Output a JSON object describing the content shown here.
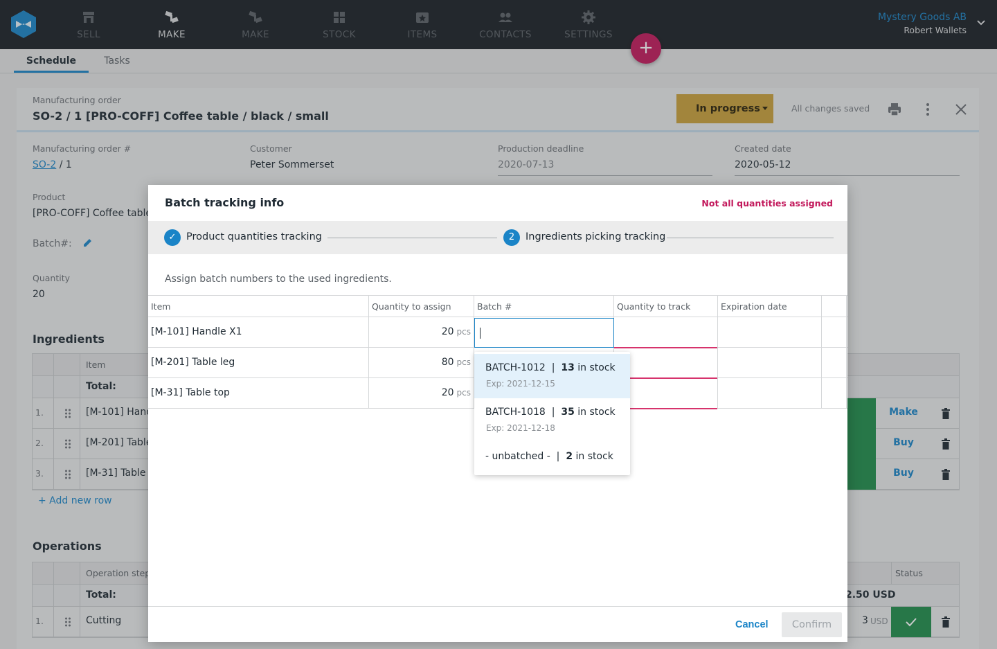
{
  "nav": {
    "items": [
      {
        "label": "SELL",
        "icon": "shop-icon"
      },
      {
        "label": "MAKE",
        "icon": "make-icon"
      },
      {
        "label": "MAKE",
        "icon": "make-icon"
      },
      {
        "label": "STOCK",
        "icon": "stock-icon"
      },
      {
        "label": "ITEMS",
        "icon": "items-icon"
      },
      {
        "label": "CONTACTS",
        "icon": "contacts-icon"
      },
      {
        "label": "SETTINGS",
        "icon": "gear-icon"
      }
    ],
    "company": "Mystery Goods AB",
    "user": "Robert Wallets",
    "add_label": "+"
  },
  "tabs": [
    "Schedule",
    "Tasks"
  ],
  "order": {
    "label": "Manufacturing order",
    "title": "SO-2 / 1 [PRO-COFF] Coffee table / black / small",
    "status": "In progress",
    "saved": "All changes saved",
    "fields": {
      "mo_label": "Manufacturing order #",
      "mo_link": "SO-2",
      "mo_rest": " / 1",
      "customer_label": "Customer",
      "customer": "Peter Sommerset",
      "deadline_label": "Production deadline",
      "deadline": "2020-07-13",
      "created_label": "Created date",
      "created": "2020-05-12",
      "product_label": "Product",
      "product": "[PRO-COFF] Coffee table /",
      "batch_label": "Batch#:",
      "quantity_label": "Quantity",
      "quantity": "20"
    },
    "ingredients": {
      "title": "Ingredients",
      "col_item": "Item",
      "total": "Total:",
      "rows": [
        {
          "n": "1.",
          "item": "[M-101] Hand",
          "action": "Make"
        },
        {
          "n": "2.",
          "item": "[M-201] Table",
          "action": "Buy"
        },
        {
          "n": "3.",
          "item": "[M-31] Table t",
          "action": "Buy"
        }
      ],
      "add_row": "+ Add new row"
    },
    "operations": {
      "title": "Operations",
      "col_step": "Operation step",
      "col_status": "Status",
      "total": "Total:",
      "total_value": "2.50 USD",
      "rows": [
        {
          "n": "1.",
          "step": "Cutting",
          "cost": "3",
          "unit": "USD"
        }
      ]
    }
  },
  "modal": {
    "title": "Batch tracking info",
    "warning": "Not all quantities assigned",
    "steps": [
      {
        "num": "✓",
        "label": "Product quantities tracking"
      },
      {
        "num": "2",
        "label": "Ingredients picking tracking"
      }
    ],
    "description": "Assign batch numbers to the used ingredients.",
    "columns": [
      "Item",
      "Quantity to assign",
      "Batch #",
      "Quantity to track",
      "Expiration date"
    ],
    "rows": [
      {
        "item": "[M-101] Handle X1",
        "qty": "20",
        "unit": "pcs"
      },
      {
        "item": "[M-201] Table leg",
        "qty": "80",
        "unit": "pcs"
      },
      {
        "item": "[M-31] Table top",
        "qty": "20",
        "unit": "pcs"
      }
    ],
    "dropdown": [
      {
        "name": "BATCH-1012",
        "sep": "  |  ",
        "count": "13",
        "suffix": " in stock",
        "exp": "Exp: 2021-12-15"
      },
      {
        "name": "BATCH-1018",
        "sep": "  |  ",
        "count": "35",
        "suffix": " in stock",
        "exp": "Exp: 2021-12-18"
      },
      {
        "name": "- unbatched -",
        "sep": "  |  ",
        "count": "2",
        "suffix": " in stock",
        "exp": ""
      }
    ],
    "cancel": "Cancel",
    "confirm": "Confirm"
  }
}
